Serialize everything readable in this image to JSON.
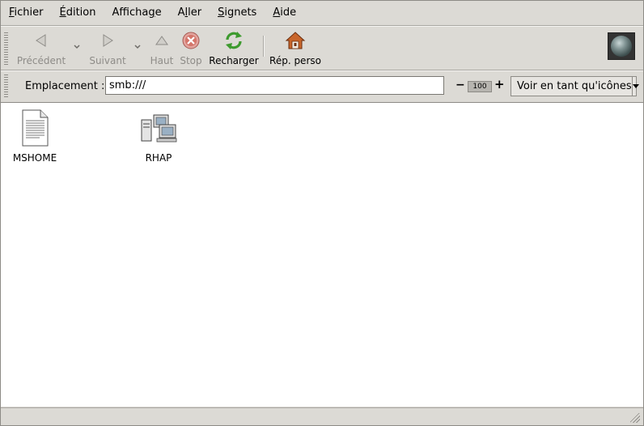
{
  "menu": {
    "items": [
      {
        "mnemonic": "F",
        "rest": "ichier"
      },
      {
        "mnemonic": "É",
        "rest": "dition"
      },
      {
        "pre": "Afficha",
        "mnemonic": "g",
        "rest": "e"
      },
      {
        "pre": "A",
        "mnemonic": "l",
        "rest": "ler"
      },
      {
        "mnemonic": "S",
        "rest": "ignets"
      },
      {
        "mnemonic": "A",
        "rest": "ide"
      }
    ]
  },
  "toolbar": {
    "back_label": "Précédent",
    "forward_label": "Suivant",
    "up_label": "Haut",
    "stop_label": "Stop",
    "reload_label": "Recharger",
    "home_label": "Rép. perso"
  },
  "location": {
    "label": "Emplacement :",
    "value": "smb:///"
  },
  "zoom": {
    "minus": "−",
    "level": "100",
    "plus": "+"
  },
  "view": {
    "selected": "Voir en tant qu'icônes"
  },
  "content": {
    "items": [
      {
        "name": "MSHOME",
        "icon": "document-icon"
      },
      {
        "name": "RHAP",
        "icon": "network-computers-icon"
      }
    ]
  },
  "colors": {
    "window_bg": "#dcdad5",
    "content_bg": "#ffffff",
    "disabled_text": "#8e8c88",
    "reload_green": "#3d9a2e",
    "stop_red": "#c0392b",
    "home_orange": "#c8652a"
  }
}
